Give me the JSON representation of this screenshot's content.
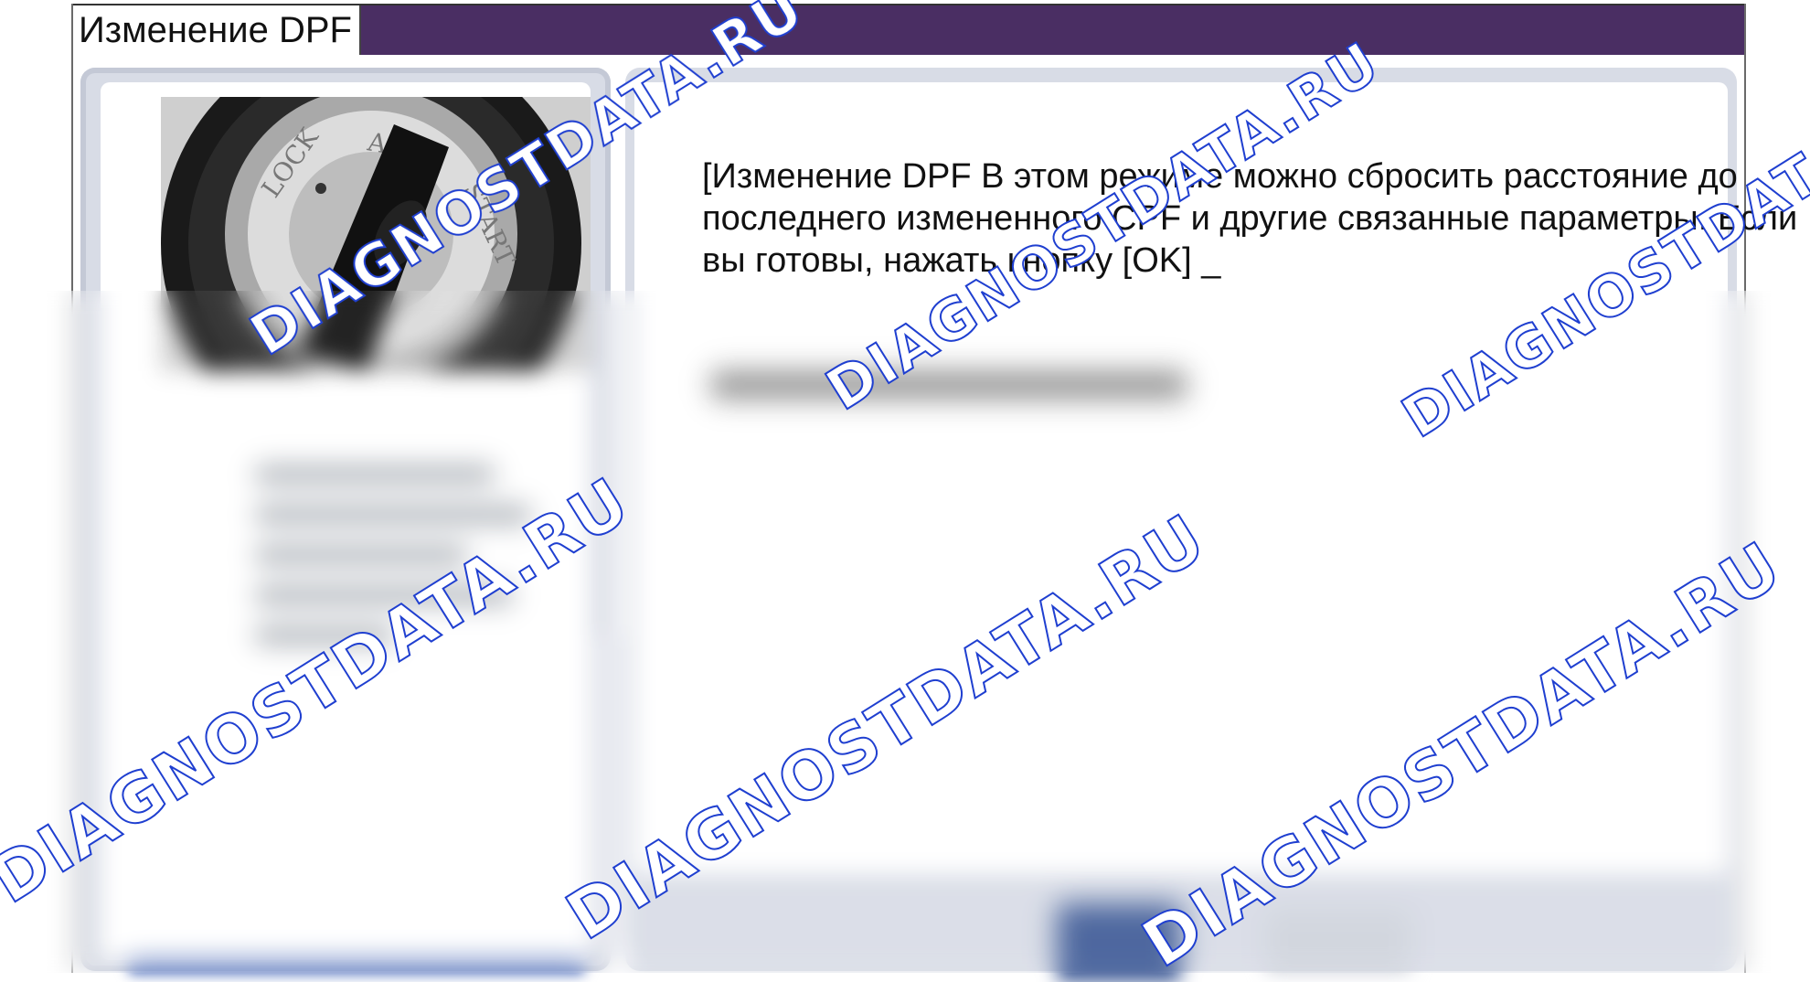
{
  "window": {
    "title": "Изменение DPF"
  },
  "message": {
    "text": "[Изменение DPF В этом режиме можно сбросить расстояние до последнего измененного CPF и другие связанные параметры. Если вы готовы, нажать кнопку [OK] _"
  },
  "photo": {
    "description_icon": "ignition-switch-icon",
    "labels": [
      "LOCK",
      "ACC",
      "START"
    ]
  },
  "watermark": {
    "text": "DIAGNOSTDATA.RU",
    "color": "#1f3fd0"
  },
  "colors": {
    "titlebar": "#4a2e63",
    "panel": "#d8dce6",
    "button": "#3f5b97"
  }
}
